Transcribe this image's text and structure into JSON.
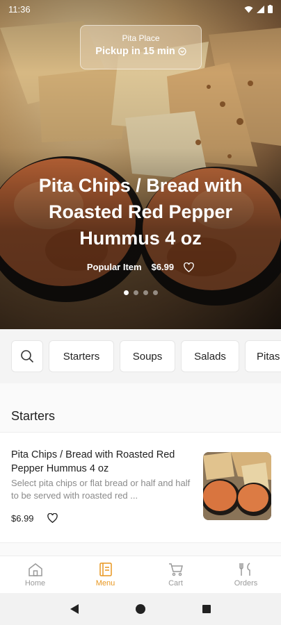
{
  "status_bar": {
    "time": "11:36"
  },
  "pickup": {
    "location": "Pita Place",
    "time_label": "Pickup in 15 min"
  },
  "hero": {
    "title": "Pita Chips / Bread with Roasted Red Pepper Hummus 4 oz",
    "tag": "Popular Item",
    "price": "$6.99",
    "carousel": {
      "pages": 4,
      "active": 0
    }
  },
  "categories": [
    "Starters",
    "Soups",
    "Salads",
    "Pitas"
  ],
  "section": {
    "title": "Starters"
  },
  "item": {
    "name": "Pita Chips / Bread with Roasted Red Pepper Hummus 4 oz",
    "description": "Select pita chips or flat bread or half and half to be served with roasted red ...",
    "price": "$6.99"
  },
  "bottom_nav": [
    {
      "label": "Home",
      "icon": "home-icon",
      "active": false
    },
    {
      "label": "Menu",
      "icon": "menu-icon",
      "active": true
    },
    {
      "label": "Cart",
      "icon": "cart-icon",
      "active": false
    },
    {
      "label": "Orders",
      "icon": "orders-icon",
      "active": false
    }
  ],
  "colors": {
    "accent": "#e8961e",
    "category_bar_bg": "#f4f4f4"
  }
}
